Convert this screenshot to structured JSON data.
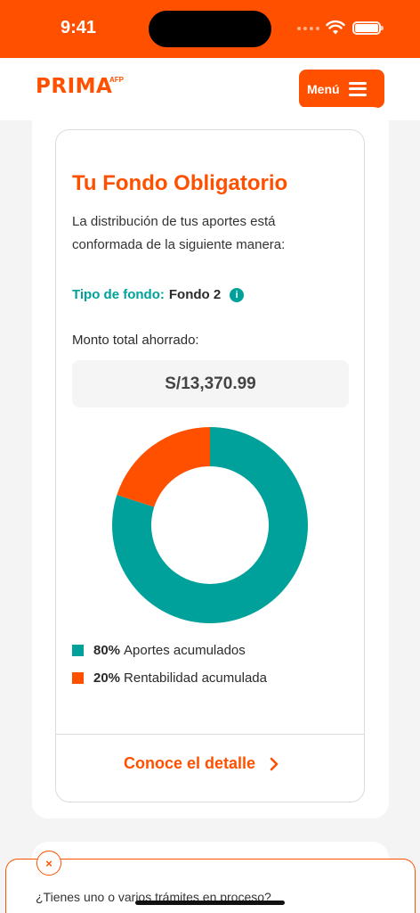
{
  "status_bar": {
    "time": "9:41",
    "background_color": "#ff5000"
  },
  "header": {
    "logo_text": "PRIMA",
    "logo_suffix": "AFP",
    "menu_label": "Menú",
    "menu_icon": "hamburger-icon"
  },
  "fund_card": {
    "title": "Tu Fondo Obligatorio",
    "description": "La distribución de tus aportes está conformada de la siguiente manera:",
    "fund_type_label": "Tipo de fondo:",
    "fund_type_value": "Fondo 2",
    "info_icon": "i",
    "total_label": "Monto total ahorrado:",
    "total_value": "S/13,370.99",
    "legend": [
      {
        "pct": "80%",
        "label": "Aportes acumulados",
        "color": "#00a19a"
      },
      {
        "pct": "20%",
        "label": "Rentabilidad acumulada",
        "color": "#ff5000"
      }
    ],
    "detail_link": "Conoce el detalle"
  },
  "chart_data": {
    "type": "pie",
    "donut": true,
    "categories": [
      "Aportes acumulados",
      "Rentabilidad acumulada"
    ],
    "values": [
      80,
      20
    ],
    "colors": [
      "#00a19a",
      "#ff5000"
    ]
  },
  "toast": {
    "close_icon": "×",
    "text": "¿Tienes uno o varios trámites en proceso?"
  },
  "colors": {
    "brand_orange": "#ff5000",
    "teal": "#00a19a"
  }
}
